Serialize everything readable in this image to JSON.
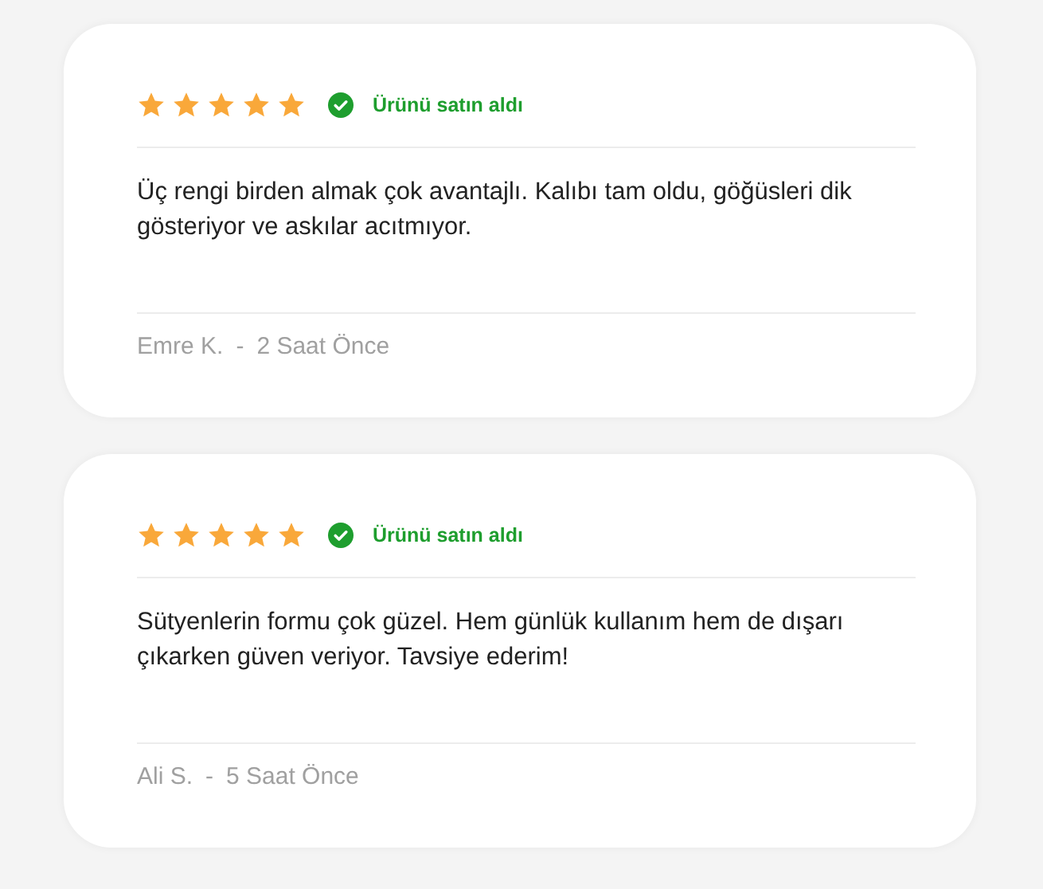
{
  "reviews": [
    {
      "stars": 5,
      "verified": true,
      "verified_label": "Ürünü satın aldı",
      "text": "Üç rengi birden almak çok avantajlı. Kalıbı tam oldu, göğüsleri dik gösteriyor ve askılar acıtmıyor.",
      "author": "Emre K.",
      "separator": "-",
      "time": "2 Saat Önce"
    },
    {
      "stars": 5,
      "verified": true,
      "verified_label": "Ürünü satın aldı",
      "text": "Sütyenlerin formu çok güzel. Hem günlük kullanım hem de dışarı çıkarken güven veriyor. Tavsiye ederim!",
      "author": "Ali S.",
      "separator": "-",
      "time": "5 Saat Önce"
    }
  ]
}
